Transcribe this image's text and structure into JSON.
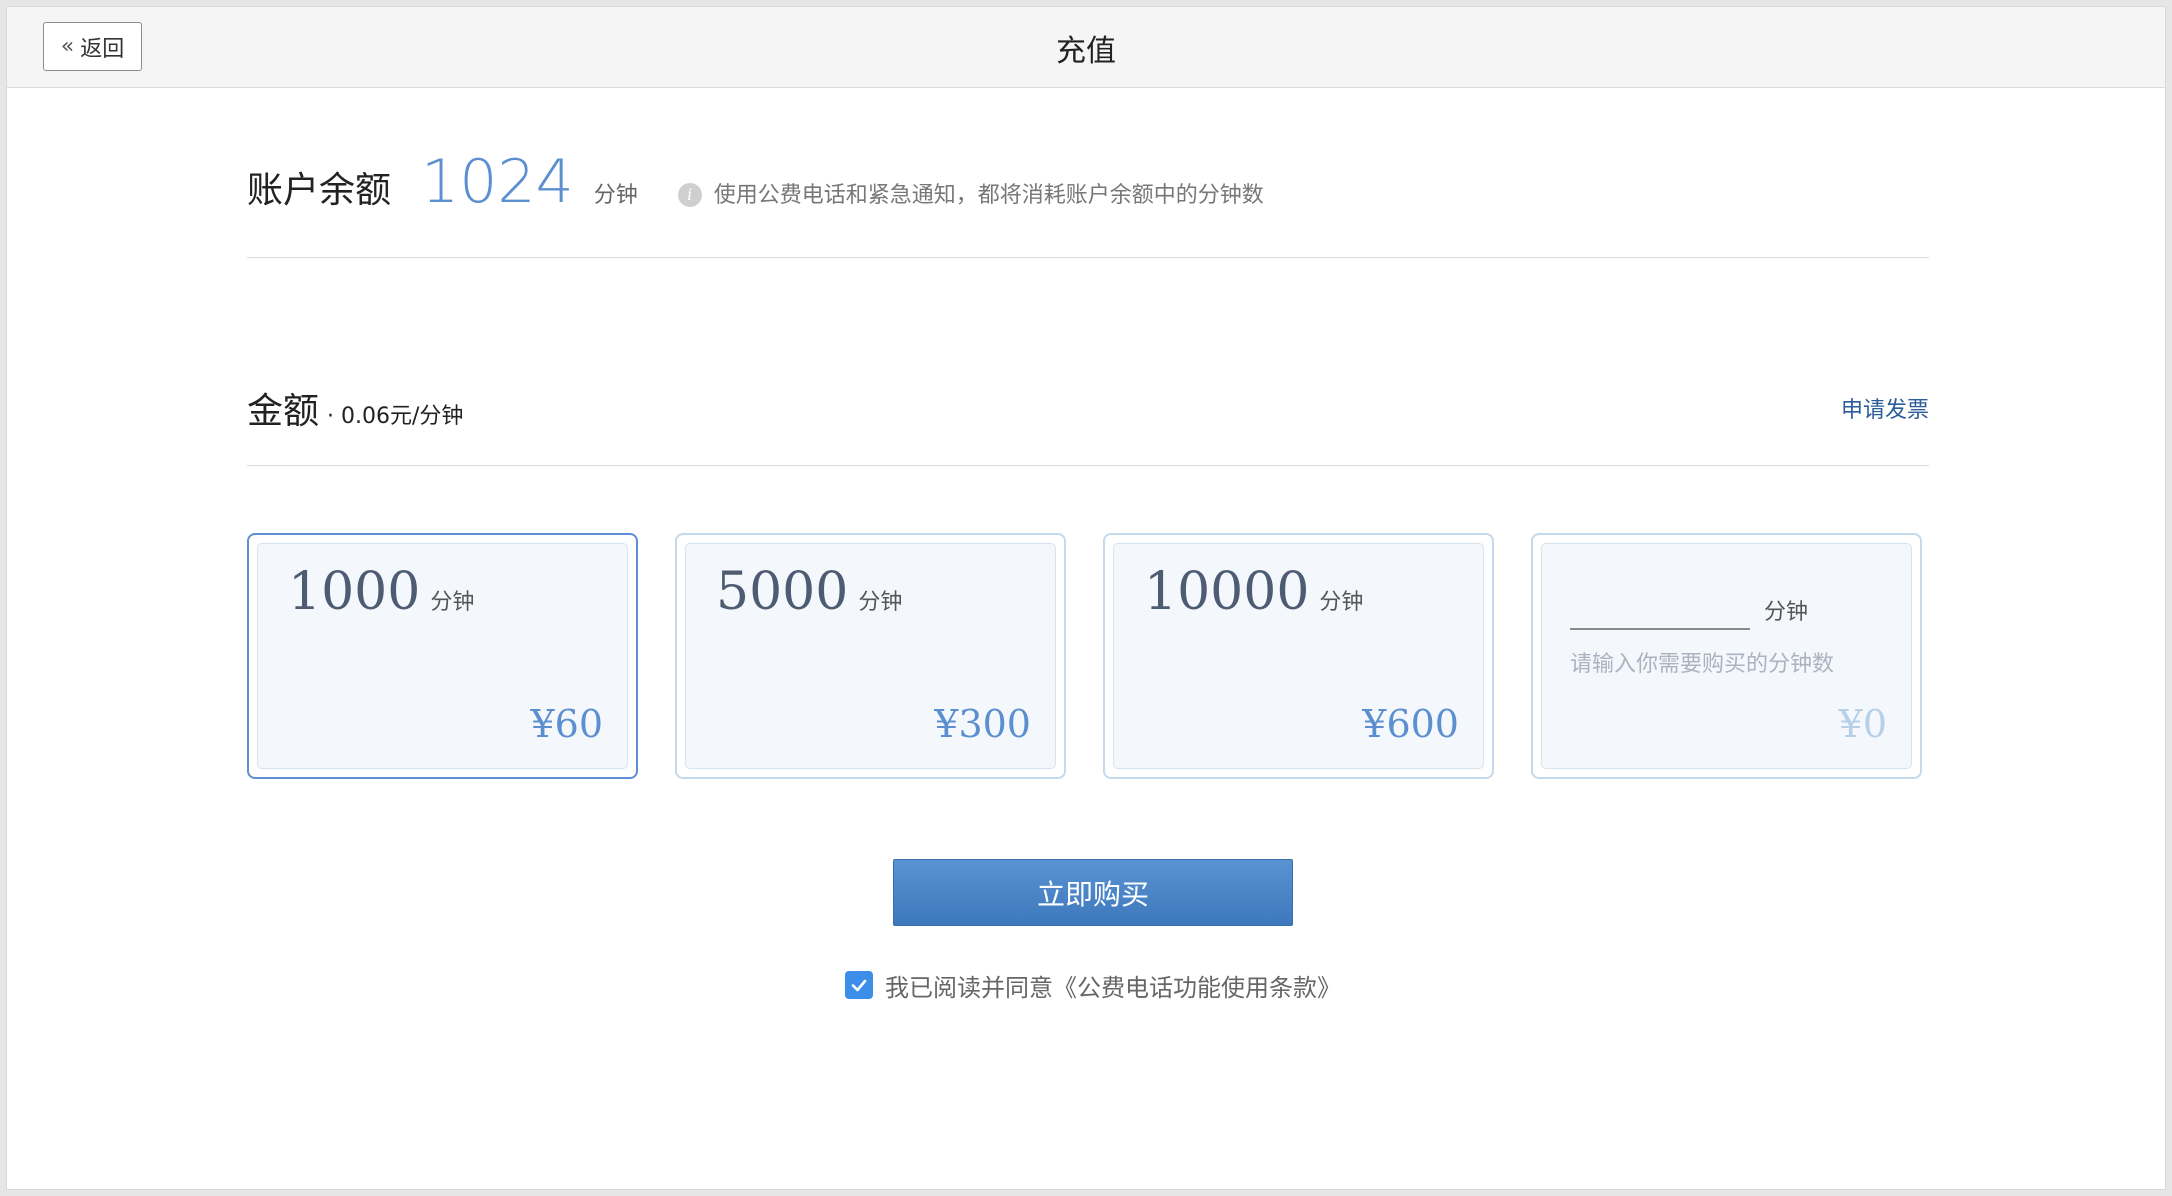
{
  "header": {
    "back_label": "返回",
    "title": "充值"
  },
  "balance": {
    "label": "账户余额",
    "value": "1024",
    "unit": "分钟",
    "note": "使用公费电话和紧急通知，都将消耗账户余额中的分钟数"
  },
  "amount": {
    "label": "金额",
    "rate": "· 0.06元/分钟",
    "invoice_link": "申请发票"
  },
  "packages": [
    {
      "minutes": "1000",
      "unit": "分钟",
      "price": "¥60",
      "selected": true
    },
    {
      "minutes": "5000",
      "unit": "分钟",
      "price": "¥300",
      "selected": false
    },
    {
      "minutes": "10000",
      "unit": "分钟",
      "price": "¥600",
      "selected": false
    }
  ],
  "custom_package": {
    "unit": "分钟",
    "placeholder": "请输入你需要购买的分钟数",
    "value": "",
    "price": "¥0"
  },
  "buy_button": "立即购买",
  "agreement": {
    "checked": true,
    "text": "我已阅读并同意《公费电话功能使用条款》"
  },
  "colors": {
    "accent": "#5b8fd0",
    "button": "#4a86c8",
    "checkbox": "#3d8ee8",
    "link": "#2b5c9b"
  }
}
